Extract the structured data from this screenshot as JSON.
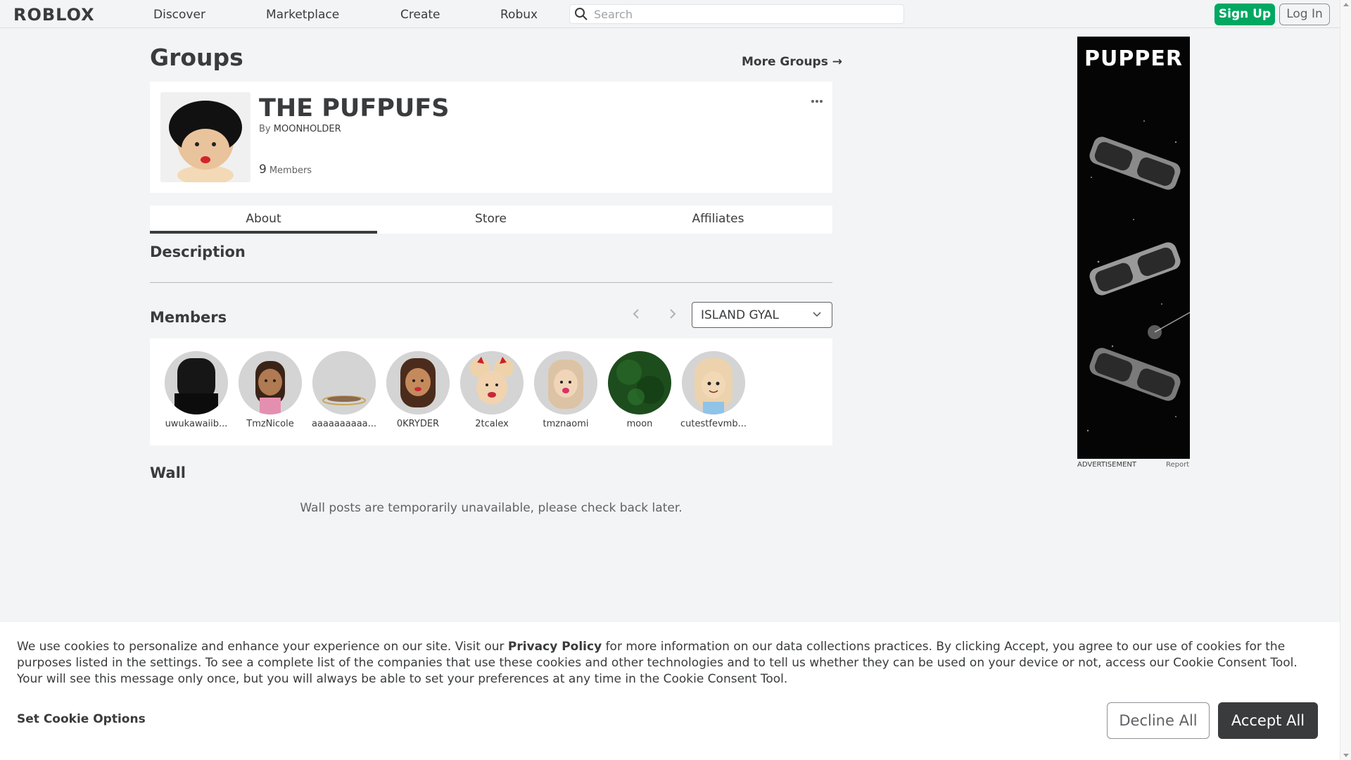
{
  "header": {
    "logo": "ROBLOX",
    "nav": [
      "Discover",
      "Marketplace",
      "Create",
      "Robux"
    ],
    "search_placeholder": "Search",
    "signup": "Sign Up",
    "login": "Log In"
  },
  "page": {
    "title": "Groups",
    "more_groups": "More Groups →"
  },
  "group": {
    "name": "THE PUFPUFS",
    "by_label": "By",
    "owner": "MOONHOLDER",
    "member_count": "9",
    "members_label": "Members",
    "more_icon": "ellipsis-icon"
  },
  "tabs": [
    "About",
    "Store",
    "Affiliates"
  ],
  "sections": {
    "description": "Description",
    "members": "Members",
    "wall": "Wall"
  },
  "members": {
    "role_selected": "ISLAND GYAL",
    "prev_icon": "chevron-left-icon",
    "next_icon": "chevron-right-icon",
    "list": [
      {
        "name": "uwukawaiib...",
        "avatar_color": "#1a1a1a"
      },
      {
        "name": "TmzNicole",
        "avatar_color": "#d6a87f"
      },
      {
        "name": "aaaaaaaaaa...",
        "avatar_color": "#d4d4d4"
      },
      {
        "name": "0KRYDER",
        "avatar_color": "#5a3a26"
      },
      {
        "name": "2tcalex",
        "avatar_color": "#eac9a8"
      },
      {
        "name": "tmznaomi",
        "avatar_color": "#e8c9a9"
      },
      {
        "name": "moon",
        "avatar_color": "#1c5a1c"
      },
      {
        "name": "cutestfevmb...",
        "avatar_color": "#f0d8ba"
      }
    ]
  },
  "wall": {
    "message": "Wall posts are temporarily unavailable, please check back later."
  },
  "ad": {
    "title": "PUPPER",
    "label": "ADVERTISEMENT",
    "report": "Report"
  },
  "cookie": {
    "text_before": "We use cookies to personalize and enhance your experience on our site. Visit our ",
    "privacy_link": "Privacy Policy",
    "text_after": " for more information on our data collections practices. By clicking Accept, you agree to our use of cookies for the purposes listed in the settings. To see a complete list of the companies that use these cookies and other technologies and to tell us whether they can be used on your device or not, access our Cookie Consent Tool. Your will see this message only once, but you will always be able to set your preferences at any time in the Cookie Consent Tool.",
    "set_options": "Set Cookie Options",
    "decline": "Decline All",
    "accept": "Accept All"
  }
}
